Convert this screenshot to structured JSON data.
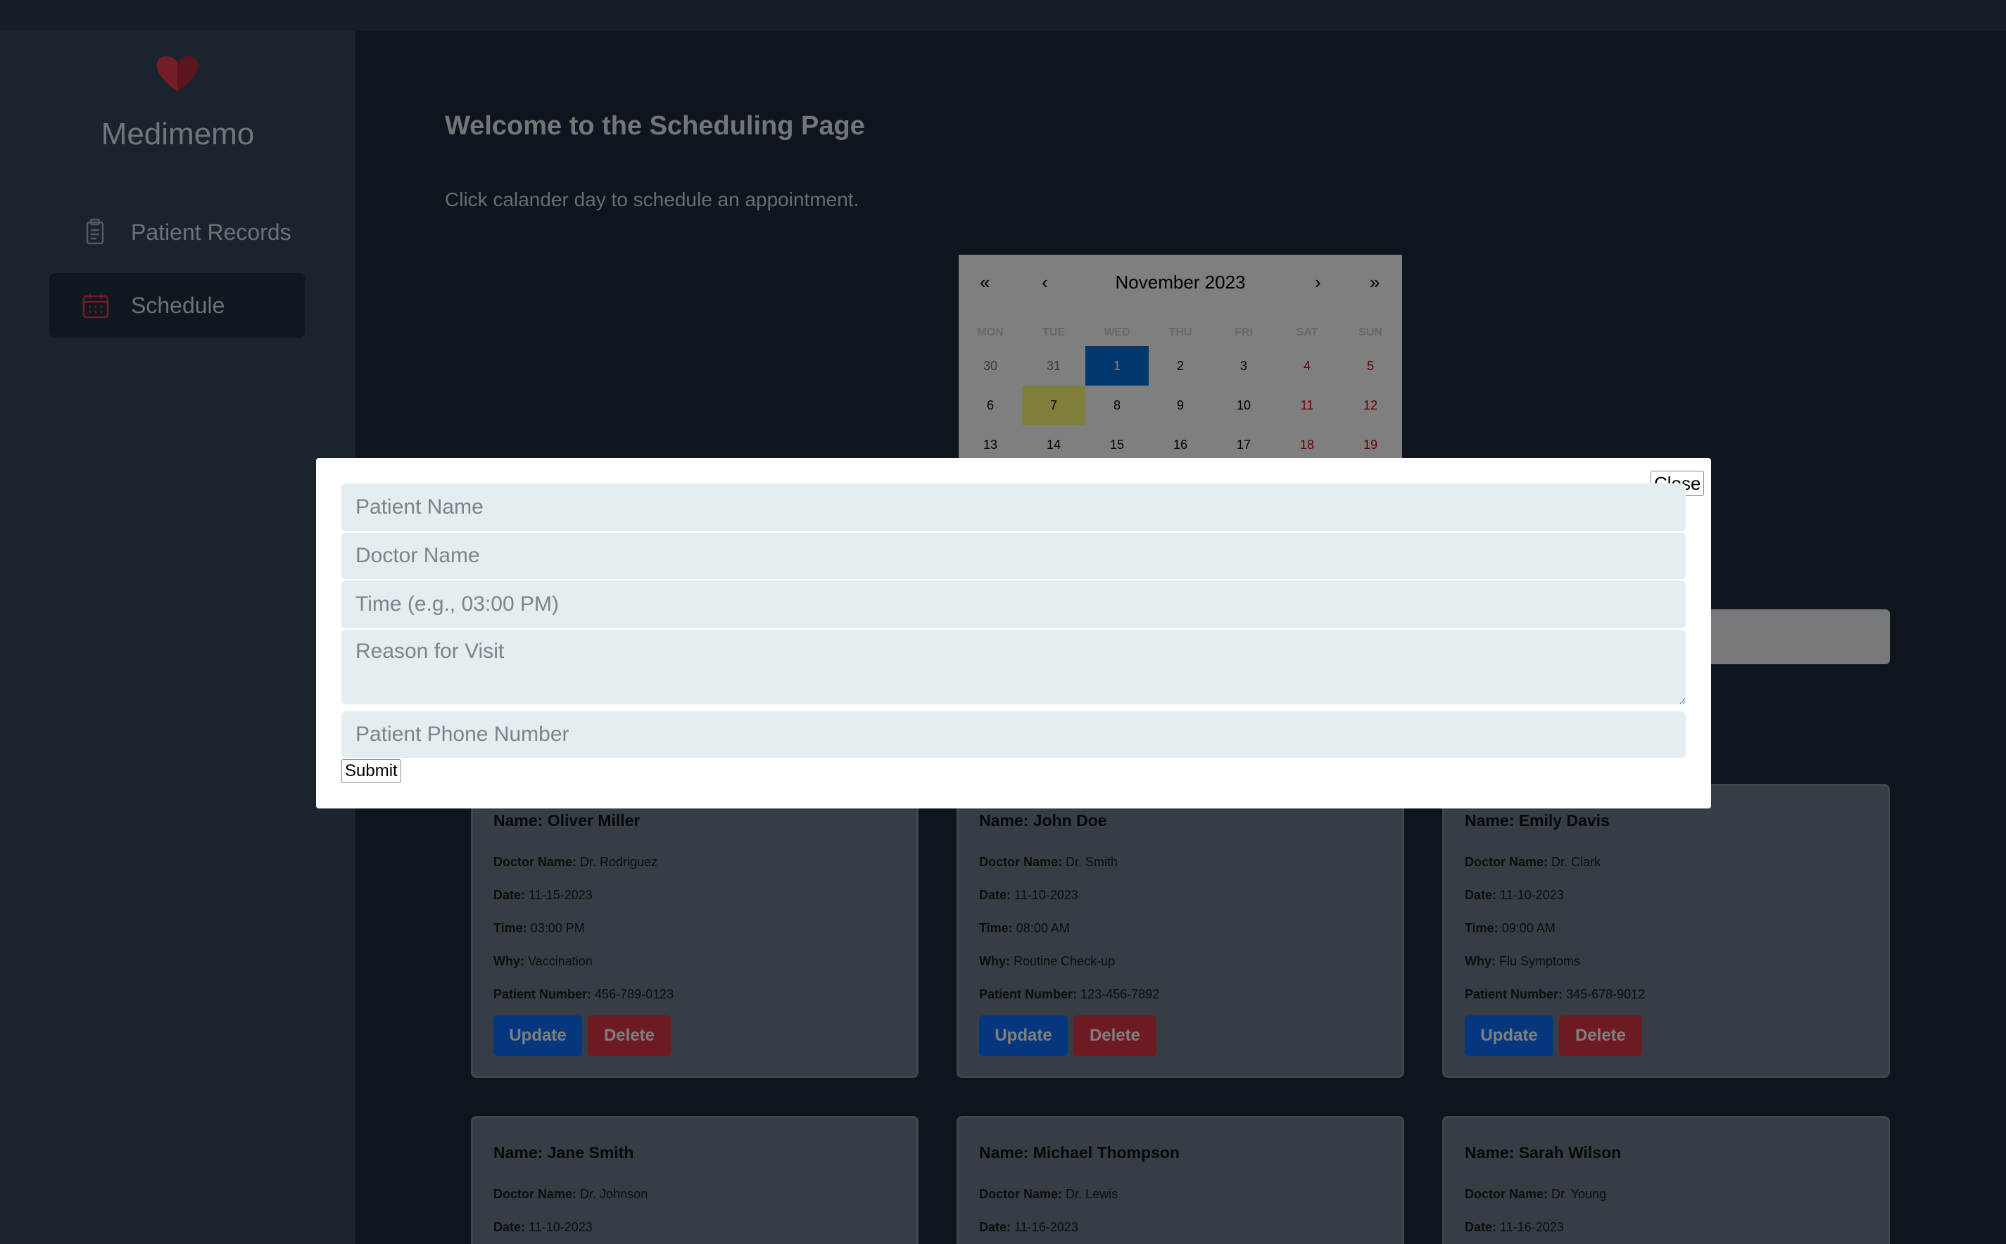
{
  "app": {
    "brand": "Medimemo"
  },
  "sidebar": {
    "items": [
      {
        "label": "Patient Records",
        "icon": "clipboard-icon",
        "active": false
      },
      {
        "label": "Schedule",
        "icon": "calendar-icon",
        "active": true
      }
    ]
  },
  "main": {
    "title": "Welcome to the Scheduling Page",
    "subtitle": "Click calander day to schedule an appointment."
  },
  "calendar": {
    "prev2": "«",
    "prev": "‹",
    "next": "›",
    "next2": "»",
    "month_label": "November 2023",
    "weekdays": [
      "MON",
      "TUE",
      "WED",
      "THU",
      "FRI",
      "SAT",
      "SUN"
    ],
    "weeks": [
      [
        "30",
        "31",
        "1",
        "2",
        "3",
        "4",
        "5"
      ],
      [
        "6",
        "7",
        "8",
        "9",
        "10",
        "11",
        "12"
      ],
      [
        "13",
        "14",
        "15",
        "16",
        "17",
        "18",
        "19"
      ]
    ],
    "selected_day": "1",
    "today_day": "7"
  },
  "modal": {
    "close_label": "Close",
    "patient_name_placeholder": "Patient Name",
    "doctor_name_placeholder": "Doctor Name",
    "time_placeholder": "Time (e.g., 03:00 PM)",
    "reason_placeholder": "Reason for Visit",
    "phone_placeholder": "Patient Phone Number",
    "submit_label": "Submit"
  },
  "labels": {
    "doctor": "Doctor Name:",
    "date": "Date:",
    "time": "Time:",
    "why": "Why:",
    "patient_number": "Patient Number:",
    "update": "Update",
    "delete": "Delete"
  },
  "appointments": [
    {
      "name": "Name: Oliver Miller",
      "doctor": "Dr. Rodriguez",
      "date": "11-15-2023",
      "time": "03:00 PM",
      "why": "Vaccination",
      "number": "456-789-0123"
    },
    {
      "name": "Name: John Doe",
      "doctor": "Dr. Smith",
      "date": "11-10-2023",
      "time": "08:00 AM",
      "why": "Routine Check-up",
      "number": "123-456-7892"
    },
    {
      "name": "Name: Emily Davis",
      "doctor": "Dr. Clark",
      "date": "11-10-2023",
      "time": "09:00 AM",
      "why": "Flu Symptoms",
      "number": "345-678-9012"
    },
    {
      "name": "Name: Jane Smith",
      "doctor": "Dr. Johnson",
      "date": "11-10-2023"
    },
    {
      "name": "Name: Michael Thompson",
      "doctor": "Dr. Lewis",
      "date": "11-16-2023"
    },
    {
      "name": "Name: Sarah Wilson",
      "doctor": "Dr. Young",
      "date": "11-16-2023"
    }
  ],
  "colors": {
    "accent_red": "#d1394a",
    "update_blue": "#0d6efd",
    "delete_red": "#dc3545",
    "calendar_selected": "#006edc",
    "calendar_today": "#ffff76"
  }
}
